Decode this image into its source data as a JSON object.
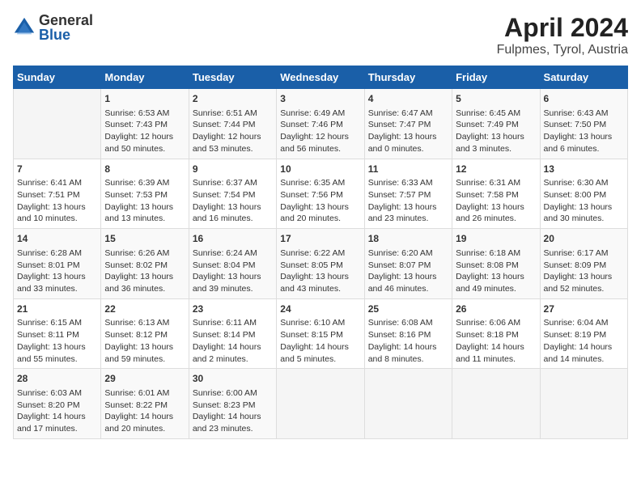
{
  "logo": {
    "general": "General",
    "blue": "Blue"
  },
  "title": "April 2024",
  "subtitle": "Fulpmes, Tyrol, Austria",
  "days_of_week": [
    "Sunday",
    "Monday",
    "Tuesday",
    "Wednesday",
    "Thursday",
    "Friday",
    "Saturday"
  ],
  "weeks": [
    [
      {
        "day": "",
        "info": ""
      },
      {
        "day": "1",
        "info": "Sunrise: 6:53 AM\nSunset: 7:43 PM\nDaylight: 12 hours\nand 50 minutes."
      },
      {
        "day": "2",
        "info": "Sunrise: 6:51 AM\nSunset: 7:44 PM\nDaylight: 12 hours\nand 53 minutes."
      },
      {
        "day": "3",
        "info": "Sunrise: 6:49 AM\nSunset: 7:46 PM\nDaylight: 12 hours\nand 56 minutes."
      },
      {
        "day": "4",
        "info": "Sunrise: 6:47 AM\nSunset: 7:47 PM\nDaylight: 13 hours\nand 0 minutes."
      },
      {
        "day": "5",
        "info": "Sunrise: 6:45 AM\nSunset: 7:49 PM\nDaylight: 13 hours\nand 3 minutes."
      },
      {
        "day": "6",
        "info": "Sunrise: 6:43 AM\nSunset: 7:50 PM\nDaylight: 13 hours\nand 6 minutes."
      }
    ],
    [
      {
        "day": "7",
        "info": "Sunrise: 6:41 AM\nSunset: 7:51 PM\nDaylight: 13 hours\nand 10 minutes."
      },
      {
        "day": "8",
        "info": "Sunrise: 6:39 AM\nSunset: 7:53 PM\nDaylight: 13 hours\nand 13 minutes."
      },
      {
        "day": "9",
        "info": "Sunrise: 6:37 AM\nSunset: 7:54 PM\nDaylight: 13 hours\nand 16 minutes."
      },
      {
        "day": "10",
        "info": "Sunrise: 6:35 AM\nSunset: 7:56 PM\nDaylight: 13 hours\nand 20 minutes."
      },
      {
        "day": "11",
        "info": "Sunrise: 6:33 AM\nSunset: 7:57 PM\nDaylight: 13 hours\nand 23 minutes."
      },
      {
        "day": "12",
        "info": "Sunrise: 6:31 AM\nSunset: 7:58 PM\nDaylight: 13 hours\nand 26 minutes."
      },
      {
        "day": "13",
        "info": "Sunrise: 6:30 AM\nSunset: 8:00 PM\nDaylight: 13 hours\nand 30 minutes."
      }
    ],
    [
      {
        "day": "14",
        "info": "Sunrise: 6:28 AM\nSunset: 8:01 PM\nDaylight: 13 hours\nand 33 minutes."
      },
      {
        "day": "15",
        "info": "Sunrise: 6:26 AM\nSunset: 8:02 PM\nDaylight: 13 hours\nand 36 minutes."
      },
      {
        "day": "16",
        "info": "Sunrise: 6:24 AM\nSunset: 8:04 PM\nDaylight: 13 hours\nand 39 minutes."
      },
      {
        "day": "17",
        "info": "Sunrise: 6:22 AM\nSunset: 8:05 PM\nDaylight: 13 hours\nand 43 minutes."
      },
      {
        "day": "18",
        "info": "Sunrise: 6:20 AM\nSunset: 8:07 PM\nDaylight: 13 hours\nand 46 minutes."
      },
      {
        "day": "19",
        "info": "Sunrise: 6:18 AM\nSunset: 8:08 PM\nDaylight: 13 hours\nand 49 minutes."
      },
      {
        "day": "20",
        "info": "Sunrise: 6:17 AM\nSunset: 8:09 PM\nDaylight: 13 hours\nand 52 minutes."
      }
    ],
    [
      {
        "day": "21",
        "info": "Sunrise: 6:15 AM\nSunset: 8:11 PM\nDaylight: 13 hours\nand 55 minutes."
      },
      {
        "day": "22",
        "info": "Sunrise: 6:13 AM\nSunset: 8:12 PM\nDaylight: 13 hours\nand 59 minutes."
      },
      {
        "day": "23",
        "info": "Sunrise: 6:11 AM\nSunset: 8:14 PM\nDaylight: 14 hours\nand 2 minutes."
      },
      {
        "day": "24",
        "info": "Sunrise: 6:10 AM\nSunset: 8:15 PM\nDaylight: 14 hours\nand 5 minutes."
      },
      {
        "day": "25",
        "info": "Sunrise: 6:08 AM\nSunset: 8:16 PM\nDaylight: 14 hours\nand 8 minutes."
      },
      {
        "day": "26",
        "info": "Sunrise: 6:06 AM\nSunset: 8:18 PM\nDaylight: 14 hours\nand 11 minutes."
      },
      {
        "day": "27",
        "info": "Sunrise: 6:04 AM\nSunset: 8:19 PM\nDaylight: 14 hours\nand 14 minutes."
      }
    ],
    [
      {
        "day": "28",
        "info": "Sunrise: 6:03 AM\nSunset: 8:20 PM\nDaylight: 14 hours\nand 17 minutes."
      },
      {
        "day": "29",
        "info": "Sunrise: 6:01 AM\nSunset: 8:22 PM\nDaylight: 14 hours\nand 20 minutes."
      },
      {
        "day": "30",
        "info": "Sunrise: 6:00 AM\nSunset: 8:23 PM\nDaylight: 14 hours\nand 23 minutes."
      },
      {
        "day": "",
        "info": ""
      },
      {
        "day": "",
        "info": ""
      },
      {
        "day": "",
        "info": ""
      },
      {
        "day": "",
        "info": ""
      }
    ]
  ]
}
